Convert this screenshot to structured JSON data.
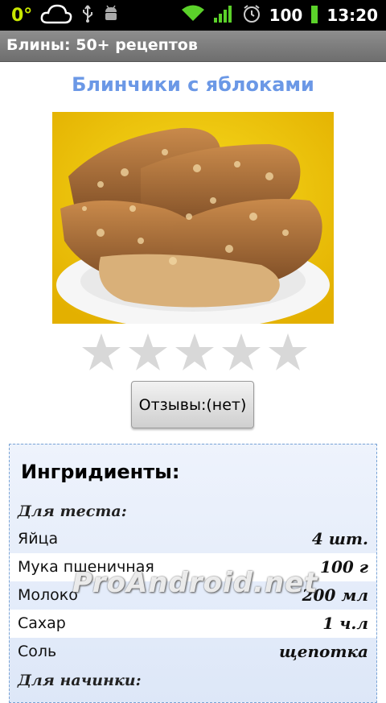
{
  "status_bar": {
    "temperature": "0°",
    "battery": "100",
    "time": "13:20"
  },
  "app_bar": {
    "title": "Блины: 50+ рецептов"
  },
  "recipe": {
    "title": "Блинчики с яблоками",
    "rating": 0,
    "max_rating": 5
  },
  "reviews_button": {
    "label": "Отзывы:(нет)"
  },
  "ingredients": {
    "heading": "Ингридиенты:",
    "section_dough": "Для теста:",
    "items": [
      {
        "name": "Яйца",
        "qty": "4 шт."
      },
      {
        "name": "Мука пшеничная",
        "qty": "100 г"
      },
      {
        "name": "Молоко",
        "qty": "200 мл"
      },
      {
        "name": "Сахар",
        "qty": "1 ч.л"
      },
      {
        "name": "Соль",
        "qty": "щепотка"
      }
    ],
    "section_filling": "Для начинки:"
  },
  "watermark": "ProAndroid.net",
  "colors": {
    "title": "#6b98e6",
    "status_bg": "#000000",
    "appbar_bg": "#7e7e7e",
    "star": "#d8d8d8"
  }
}
